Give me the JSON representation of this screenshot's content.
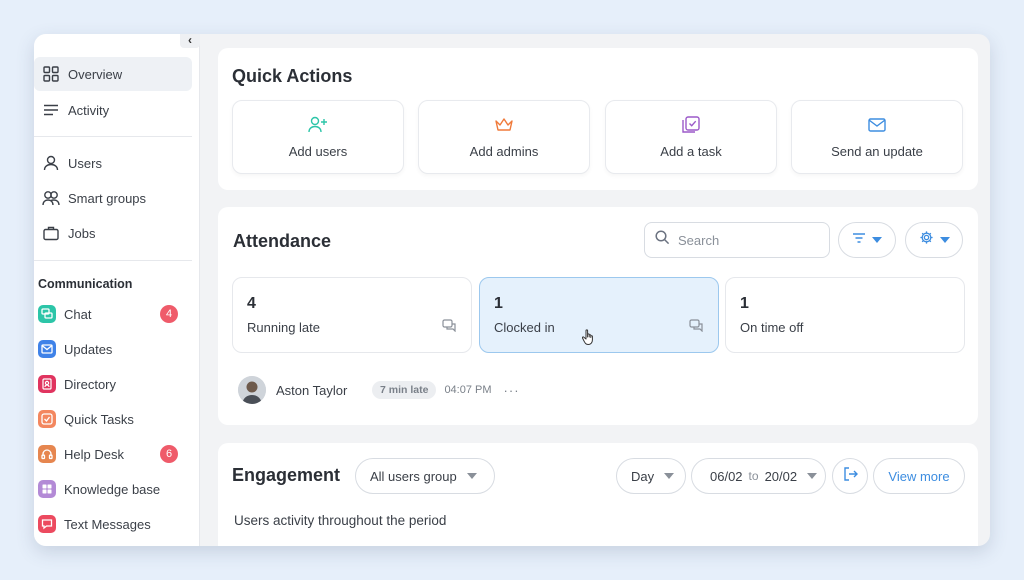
{
  "sidebar": {
    "nav": [
      {
        "label": "Overview",
        "icon": "grid-icon"
      },
      {
        "label": "Activity",
        "icon": "lines-icon"
      }
    ],
    "people": [
      {
        "label": "Users",
        "icon": "user-icon"
      },
      {
        "label": "Smart groups",
        "icon": "users-icon"
      },
      {
        "label": "Jobs",
        "icon": "briefcase-icon"
      }
    ],
    "communication_title": "Communication",
    "apps": [
      {
        "label": "Chat",
        "badge": "4",
        "color": "#2cc5a8"
      },
      {
        "label": "Updates",
        "badge": "",
        "color": "#3f82e8"
      },
      {
        "label": "Directory",
        "badge": "",
        "color": "#e0345f"
      },
      {
        "label": "Quick Tasks",
        "badge": "",
        "color": "#f3875f"
      },
      {
        "label": "Help Desk",
        "badge": "6",
        "color": "#e6864f"
      },
      {
        "label": "Knowledge base",
        "badge": "",
        "color": "#b38ad6"
      },
      {
        "label": "Text Messages",
        "badge": "",
        "color": "#ec4a5f"
      }
    ]
  },
  "quick_actions": {
    "title": "Quick Actions",
    "items": [
      {
        "label": "Add users",
        "icon": "add-user-icon",
        "color": "#2cc5a8"
      },
      {
        "label": "Add admins",
        "icon": "crown-icon",
        "color": "#f07a3a"
      },
      {
        "label": "Add a task",
        "icon": "task-icon",
        "color": "#9b59c9"
      },
      {
        "label": "Send an update",
        "icon": "mail-icon",
        "color": "#3d8de0"
      }
    ]
  },
  "attendance": {
    "title": "Attendance",
    "search_placeholder": "Search",
    "stats": [
      {
        "num": "4",
        "label": "Running late"
      },
      {
        "num": "1",
        "label": "Clocked in"
      },
      {
        "num": "1",
        "label": "On time off"
      }
    ],
    "row": {
      "name": "Aston Taylor",
      "tag": "7 min late",
      "time": "04:07 PM",
      "more": "···"
    }
  },
  "engagement": {
    "title": "Engagement",
    "group_select": "All users group",
    "period_select": "Day",
    "date_from": "06/02",
    "date_to_word": "to",
    "date_to": "20/02",
    "view_more": "View more",
    "subtitle": "Users activity throughout the period"
  },
  "colors": {
    "accent": "#3d8de0",
    "badge": "#ef5b6a"
  }
}
